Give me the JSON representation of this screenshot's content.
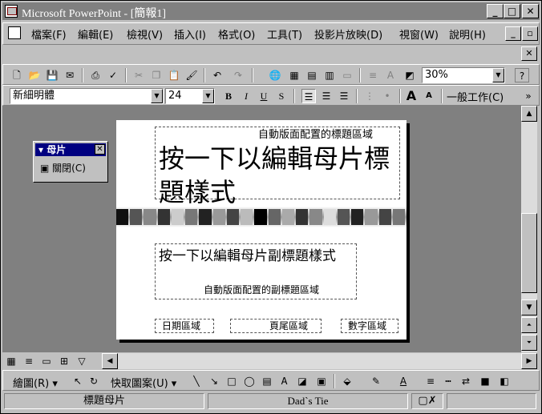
{
  "window": {
    "title": "Microsoft PowerPoint - [簡報1]",
    "caption_buttons": [
      "_",
      "□",
      "✕"
    ]
  },
  "menubar": {
    "items": [
      "檔案(F)",
      "編輯(E)",
      "檢視(V)",
      "插入(I)",
      "格式(O)",
      "工具(T)",
      "投影片放映(D)",
      "視窗(W)",
      "說明(H)"
    ],
    "doc_buttons": [
      "_",
      "▫"
    ],
    "close_label": "✕"
  },
  "standard_toolbar": {
    "zoom": "30%",
    "help_label": "?"
  },
  "format_toolbar": {
    "font": "新細明體",
    "size": "24",
    "bold": "B",
    "italic": "I",
    "underline": "U",
    "shadow": "S",
    "common_tasks": "一般工作(C)"
  },
  "slide": {
    "title_placeholder_label": "自動版面配置的標題區域",
    "title_text": "按一下以編輯母片標題樣式",
    "subtitle_text": "按一下以編輯母片副標題樣式",
    "subtitle_placeholder_label": "自動版面配置的副標題區域",
    "footer": {
      "date": "日期區域",
      "footer_area": "頁尾區域",
      "number": "數字區域"
    },
    "stripe_colors": [
      "#111111",
      "#555555",
      "#888888",
      "#333333",
      "#cccccc",
      "#777777",
      "#222222",
      "#999999",
      "#444444",
      "#bbbbbb",
      "#000000",
      "#666666",
      "#aaaaaa",
      "#333333",
      "#888888",
      "#dddddd",
      "#555555",
      "#222222",
      "#999999",
      "#444444",
      "#777777"
    ]
  },
  "master_panel": {
    "title": "母片",
    "button": "關閉(C)"
  },
  "drawing_toolbar": {
    "draw": "繪圖(R)",
    "autoshapes": "快取圖案(U)"
  },
  "statusbar": {
    "view": "標題母片",
    "template": "Dad`s Tie"
  },
  "colors": {
    "titlebar_inactive": "#808080",
    "workspace": "#808080",
    "panel_title": "#000080",
    "chrome": "#c0c0c0"
  }
}
